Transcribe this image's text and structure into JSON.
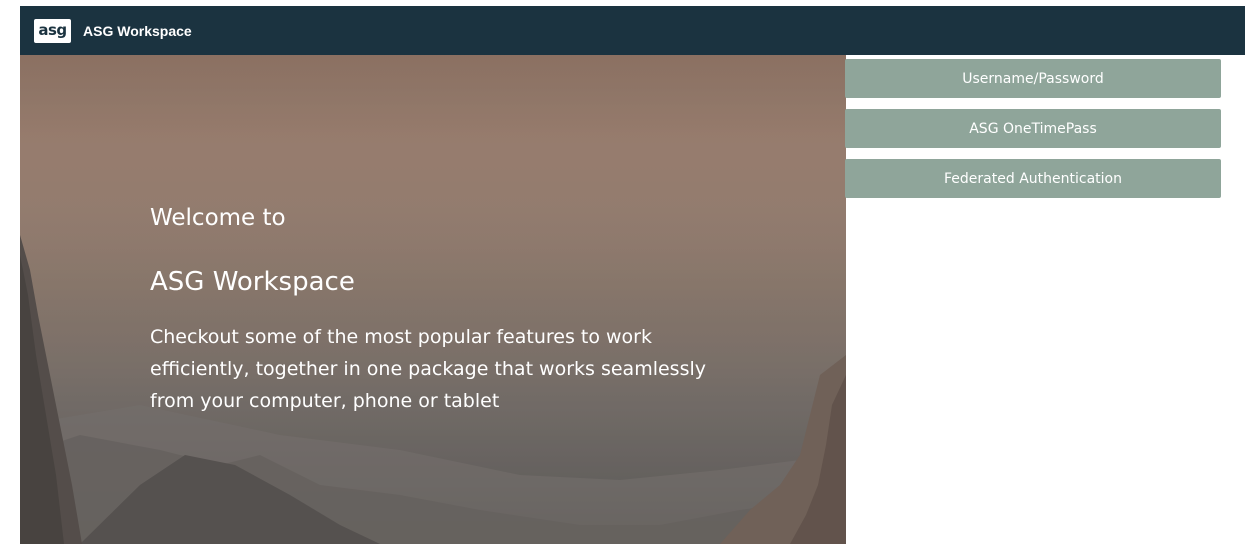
{
  "topbar": {
    "logo_text": "asg",
    "app_title": "ASG Workspace",
    "background_color": "#1b3340"
  },
  "hero": {
    "welcome": "Welcome to",
    "title": "ASG Workspace",
    "description": "Checkout some of the most popular features to work efficiently, together in one package that works seamlessly from your computer, phone or tablet",
    "background_image": "mountain-valley-landscape"
  },
  "auth": {
    "button_color": "#8fa59a",
    "options": [
      {
        "label": "Username/Password"
      },
      {
        "label": "ASG OneTimePass"
      },
      {
        "label": "Federated Authentication"
      }
    ]
  }
}
